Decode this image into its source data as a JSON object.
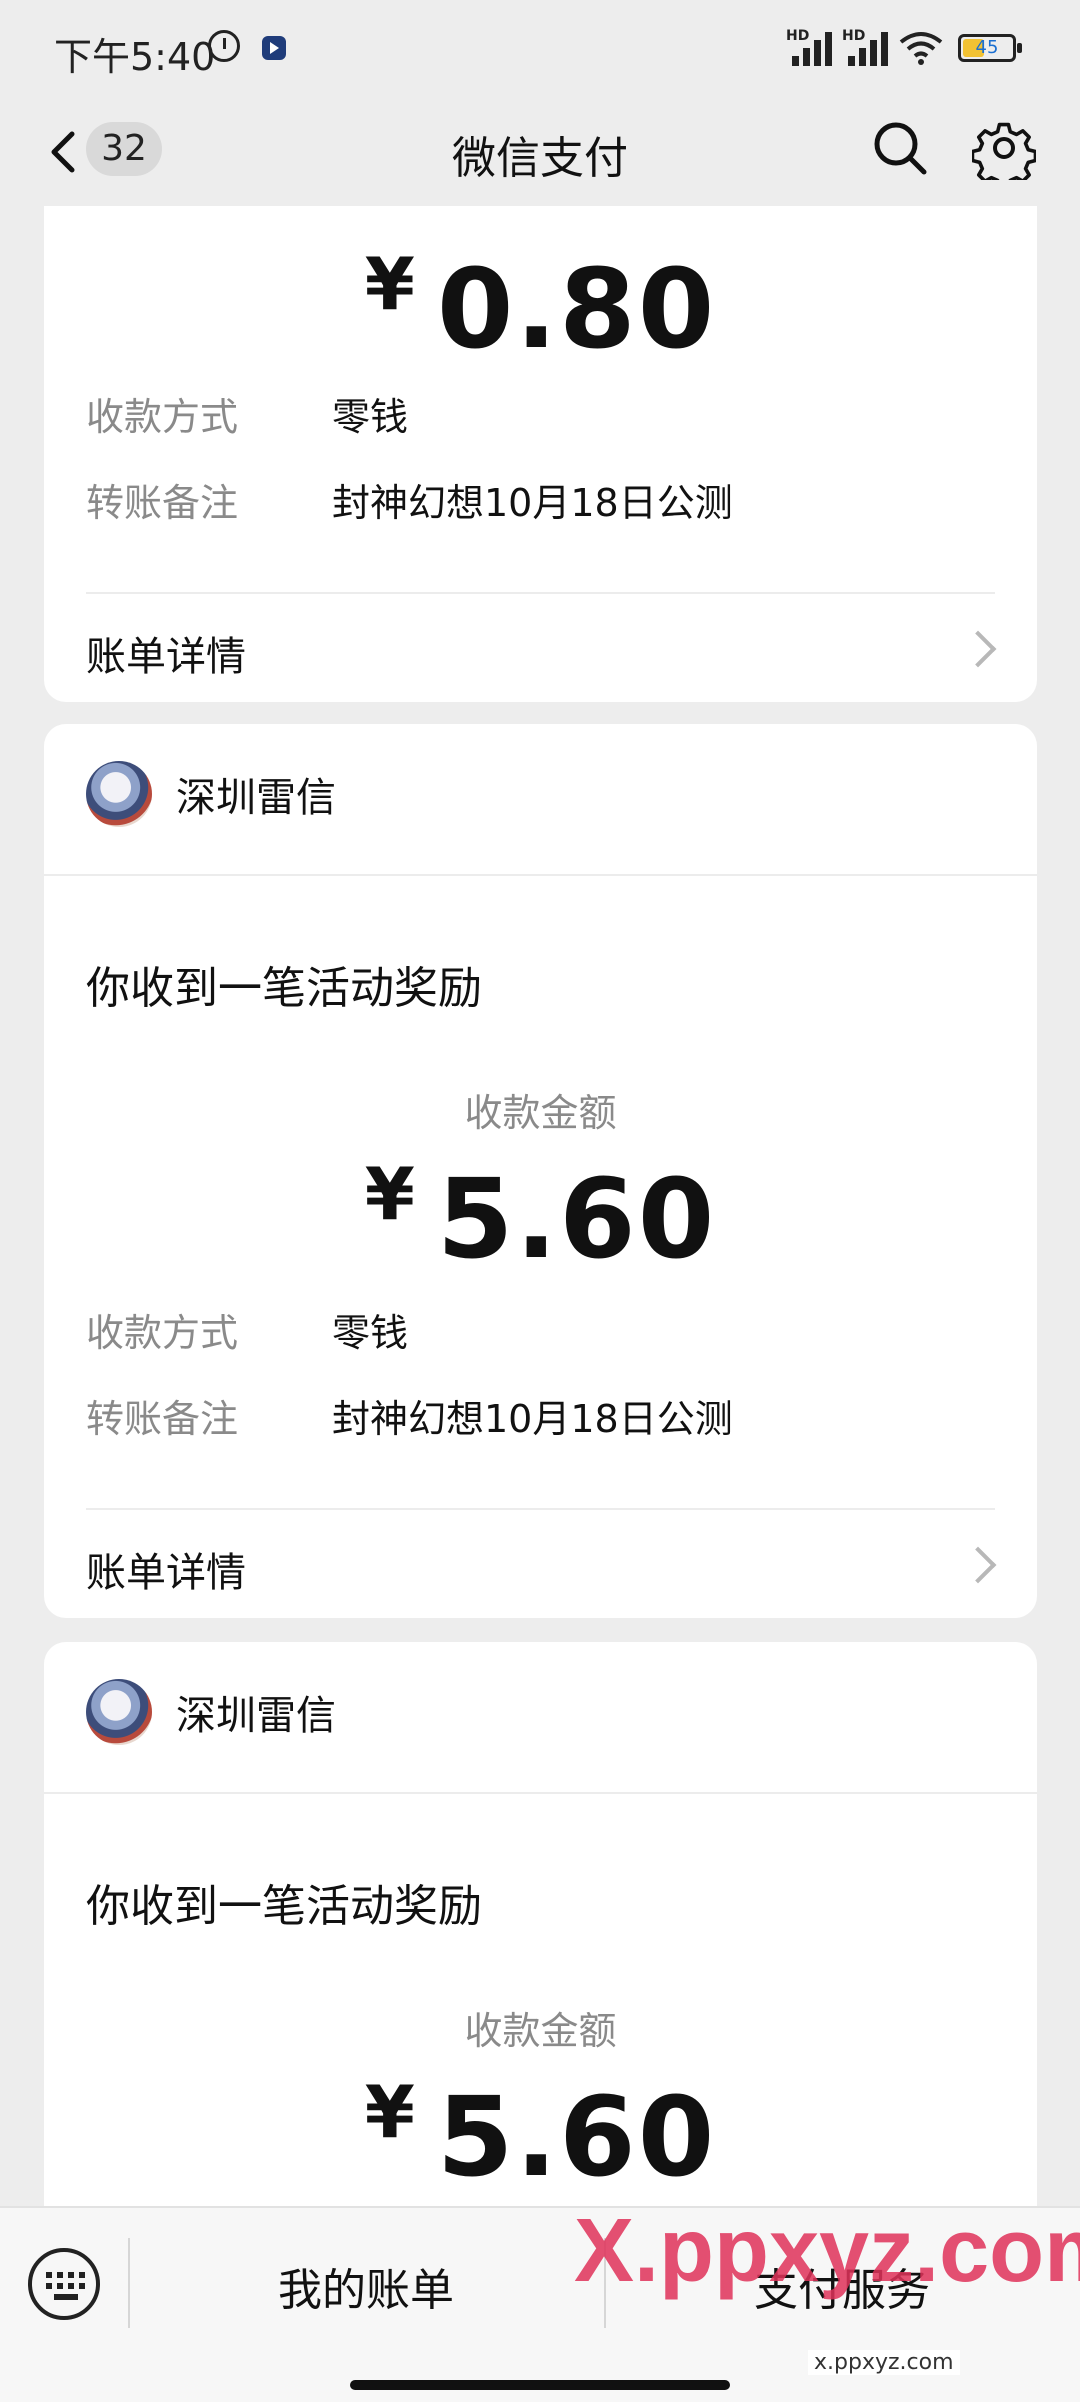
{
  "status_bar": {
    "time": "下午5:40",
    "battery": "45",
    "hd1": "HD",
    "hd2": "HD"
  },
  "nav": {
    "back_badge": "32",
    "title": "微信支付"
  },
  "cards": [
    {
      "amount_currency": "¥",
      "amount": "0.80",
      "method_label": "收款方式",
      "method_value": "零钱",
      "note_label": "转账备注",
      "note_value": "封神幻想10月18日公测",
      "detail_label": "账单详情"
    },
    {
      "sender": "深圳雷信",
      "headline": "你收到一笔活动奖励",
      "amount_label": "收款金额",
      "amount_currency": "¥",
      "amount": "5.60",
      "method_label": "收款方式",
      "method_value": "零钱",
      "note_label": "转账备注",
      "note_value": "封神幻想10月18日公测",
      "detail_label": "账单详情"
    },
    {
      "sender": "深圳雷信",
      "headline": "你收到一笔活动奖励",
      "amount_label": "收款金额",
      "amount_currency": "¥",
      "amount": "5.60"
    }
  ],
  "bottom_bar": {
    "tab1": "我的账单",
    "tab2": "支付服务"
  },
  "watermark": {
    "text": "X.ppxyz.com",
    "sub": "x.ppxyz.com"
  }
}
